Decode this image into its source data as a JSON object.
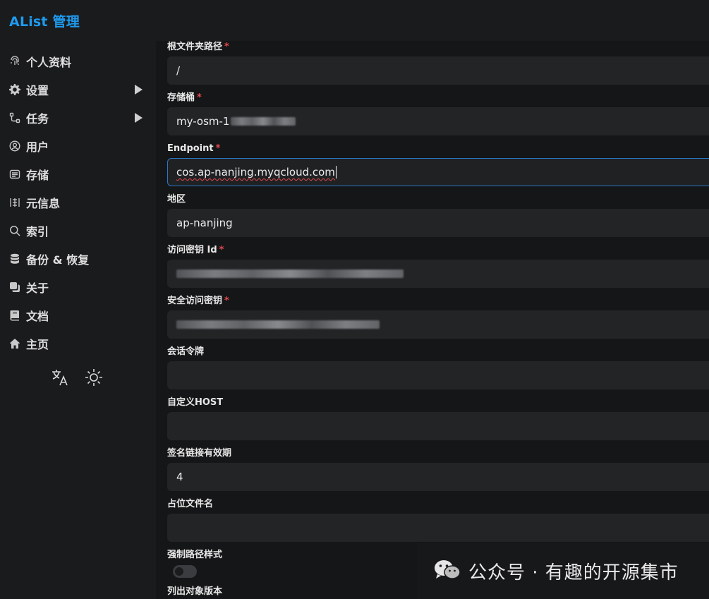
{
  "brand": "AList 管理",
  "sidebar": {
    "items": [
      {
        "label": "个人资料",
        "icon": "fingerprint-icon"
      },
      {
        "label": "设置",
        "icon": "gear-icon",
        "expandable": true
      },
      {
        "label": "任务",
        "icon": "tasks-icon",
        "expandable": true
      },
      {
        "label": "用户",
        "icon": "user-circle-icon"
      },
      {
        "label": "存储",
        "icon": "storage-icon"
      },
      {
        "label": "元信息",
        "icon": "meta-icon"
      },
      {
        "label": "索引",
        "icon": "search-icon"
      },
      {
        "label": "备份 & 恢复",
        "icon": "database-icon"
      },
      {
        "label": "关于",
        "icon": "copy-icon"
      },
      {
        "label": "文档",
        "icon": "book-icon"
      },
      {
        "label": "主页",
        "icon": "home-icon"
      }
    ],
    "tools": [
      "translate-icon",
      "sun-icon"
    ]
  },
  "form": {
    "fields": [
      {
        "label": "根文件夹路径",
        "required": true,
        "value": "/"
      },
      {
        "label": "存储桶",
        "required": true,
        "value": "my-osm-1"
      },
      {
        "label": "Endpoint",
        "required": true,
        "value": "cos.ap-nanjing.myqcloud.com",
        "focused": true
      },
      {
        "label": "地区",
        "required": false,
        "value": "ap-nanjing"
      },
      {
        "label": "访问密钥 Id",
        "required": true,
        "value": ""
      },
      {
        "label": "安全访问密钥",
        "required": true,
        "value": ""
      },
      {
        "label": "会话令牌",
        "required": false,
        "value": ""
      },
      {
        "label": "自定义HOST",
        "required": false,
        "value": ""
      },
      {
        "label": "签名链接有效期",
        "required": false,
        "value": "4"
      },
      {
        "label": "占位文件名",
        "required": false,
        "value": ""
      }
    ],
    "toggle_label": "强制路径样式",
    "toggle_on": false,
    "last_label": "列出对象版本"
  },
  "watermark": {
    "text": "公众号 · 有趣的开源集市",
    "icon": "wechat-icon"
  },
  "colors": {
    "accent": "#1e9bf0",
    "required": "#e5484d",
    "input_bg": "#222426",
    "focus_border": "#2a78c7"
  }
}
